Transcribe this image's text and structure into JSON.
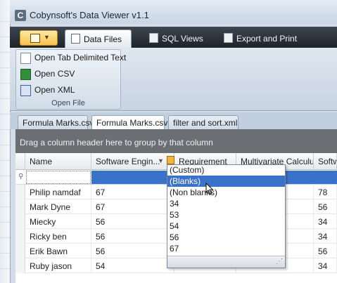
{
  "window": {
    "title": "Cobynsoft's Data Viewer v1.1",
    "icon_letter": "C"
  },
  "ribbon": {
    "tabs": [
      {
        "label": "Data Files",
        "icon": "document-icon",
        "active": true
      },
      {
        "label": "SQL Views",
        "icon": "sql-view-icon"
      },
      {
        "label": "Export and Print",
        "icon": "printer-icon"
      }
    ],
    "file_group": {
      "label": "Open File",
      "buttons": [
        {
          "label": "Open Tab Delimited Text",
          "icon": "text-file-icon"
        },
        {
          "label": "Open CSV",
          "icon": "csv-file-icon"
        },
        {
          "label": "Open XML",
          "icon": "xml-file-icon"
        }
      ]
    }
  },
  "document_tabs": [
    {
      "label": "Formula Marks.csv"
    },
    {
      "label": "Formula Marks.csv",
      "active": true
    },
    {
      "label": "filter and sort.xml"
    }
  ],
  "grid": {
    "group_hint": "Drag a column header here to group by that column",
    "columns": [
      "Name",
      "Software Engin...",
      "Requirement",
      "Multivariate Calculus",
      "Softw"
    ],
    "rows": [
      [
        "Philip namdaf",
        "67",
        "",
        "",
        "78"
      ],
      [
        "Mark Dyne",
        "67",
        "",
        "",
        "56"
      ],
      [
        "Miecky",
        "56",
        "",
        "",
        "34"
      ],
      [
        "Ricky ben",
        "56",
        "",
        "",
        "34"
      ],
      [
        "Erik Bawn",
        "56",
        "",
        "",
        "56"
      ],
      [
        "Ruby jason",
        "54",
        "",
        "",
        "34"
      ]
    ]
  },
  "filter_dropdown": {
    "options": [
      "(Custom)",
      "(Blanks)",
      "(Non blanks)",
      "34",
      "53",
      "54",
      "56",
      "67"
    ],
    "selected": "(Blanks)"
  },
  "colors": {
    "selection": "#3b72c9",
    "group_panel": "#6b6f74",
    "ribbon_dark": "#1e2329"
  }
}
